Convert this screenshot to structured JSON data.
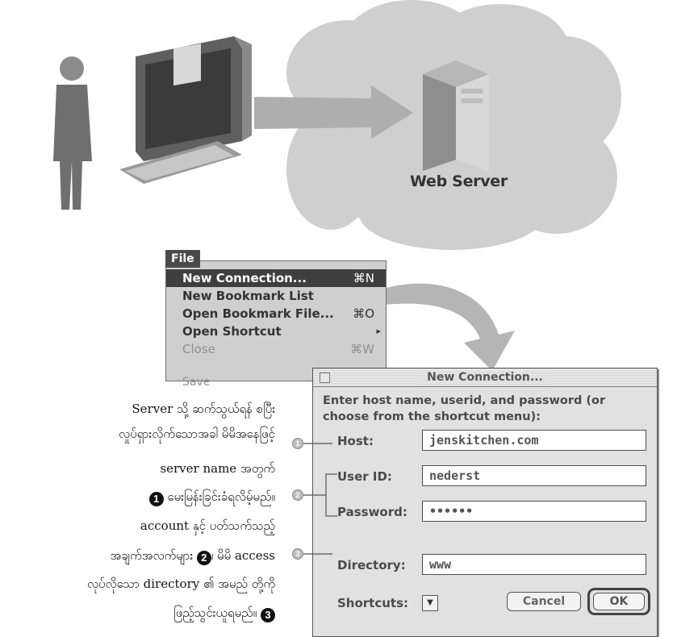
{
  "illustration": {
    "web_server_label": "Web Server"
  },
  "file_menu": {
    "title": "File",
    "items": [
      {
        "label": "New Connection...",
        "shortcut": "⌘N"
      },
      {
        "label": "New Bookmark List",
        "shortcut": ""
      },
      {
        "label": "Open Bookmark File...",
        "shortcut": "⌘O"
      },
      {
        "label": "Open Shortcut",
        "shortcut": "▸"
      },
      {
        "label": "Close",
        "shortcut": "⌘W"
      }
    ],
    "save_label": "Save"
  },
  "dialog": {
    "title": "New Connection...",
    "instructions": "Enter host name, userid, and password (or choose from the shortcut menu):",
    "fields": {
      "host": {
        "label": "Host:",
        "value": "jenskitchen.com"
      },
      "user_id": {
        "label": "User ID:",
        "value": "nederst"
      },
      "password": {
        "label": "Password:",
        "value": "••••••"
      },
      "directory": {
        "label": "Directory:",
        "value": "www"
      },
      "shortcuts": {
        "label": "Shortcuts:"
      }
    },
    "cancel_label": "Cancel",
    "ok_label": "OK",
    "callouts": {
      "one": "1",
      "two": "2",
      "three": "3"
    }
  },
  "explanation": {
    "line1": "Server သို့ ဆက်သွယ်ရန် စပြီး",
    "line2": "လှုပ်ရှားလိုက်သောအခါ မိမိအနေဖြင့်",
    "line3": "server name အတွက်",
    "line4": "မေးမြန်းခြင်းခံရလိမ့်မည်။",
    "line5": "account နှင့် ပတ်သက်သည့်",
    "line6a": "အချက်အလက်များ",
    "line6b": "၊ မိမိ access",
    "line7": "လုပ်လိုသော directory ၏ အမည် တို့ကို",
    "line8": "ဖြည့်သွင်းယူရမည်။",
    "num1": "1",
    "num2": "2",
    "num3": "3"
  }
}
